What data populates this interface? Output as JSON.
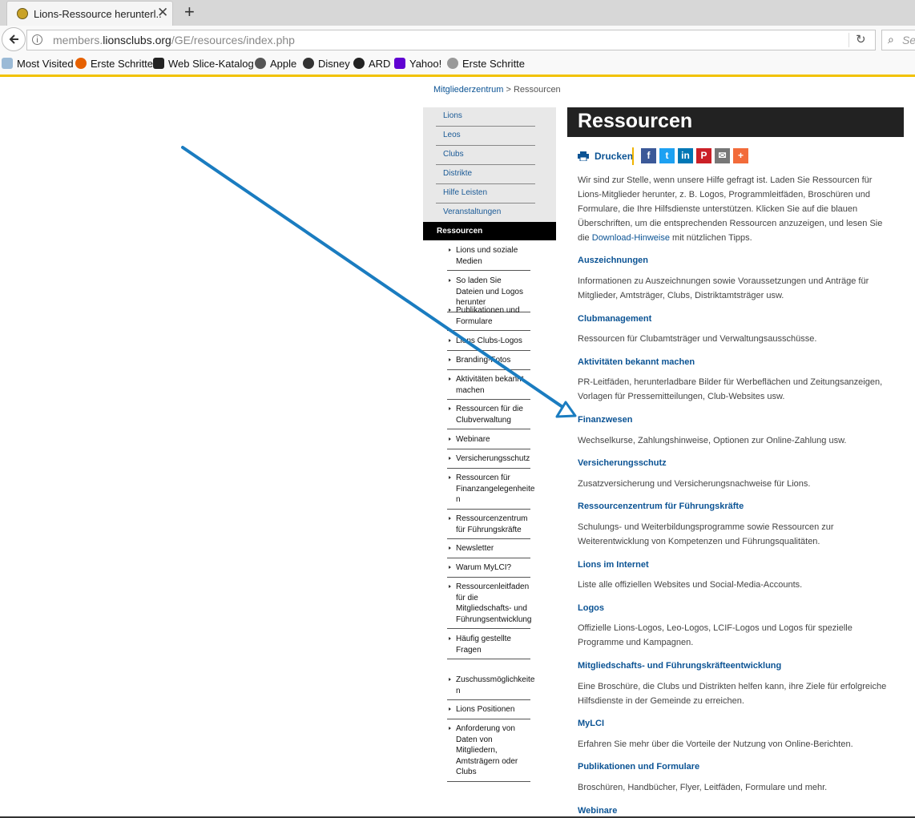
{
  "browser": {
    "tab_title": "Lions-Ressource herunterl...",
    "tab_close": "✕",
    "new_tab": "+",
    "url_prefix": "members.",
    "url_domain": "lionsclubs.org",
    "url_path": "/GE/resources/index.php",
    "search_placeholder": "Se",
    "bookmarks": [
      "Most Visited",
      "Erste Schritte",
      "Web Slice-Katalog",
      "Apple",
      "Disney",
      "ARD",
      "Yahoo!",
      "Erste Schritte"
    ]
  },
  "breadcrumb": {
    "parent": "Mitgliederzentrum",
    "separator": ">",
    "current": "Ressourcen"
  },
  "sidebar": {
    "top_items": [
      "Lions",
      "Leos",
      "Clubs",
      "Distrikte",
      "Hilfe Leisten",
      "Veranstaltungen"
    ],
    "active": "Ressourcen",
    "sub_items": [
      "Lions und soziale Medien",
      "So laden Sie Dateien und Logos herunter",
      "Publikationen und Formulare",
      "Lions Clubs-Logos",
      "Branding-Fotos",
      "Aktivitäten bekannt machen",
      "Ressourcen für die Clubverwaltung",
      "Webinare",
      "Versicherungsschutz",
      "Ressourcen für Finanzangelegenheite n",
      "Ressourcenzentrum für Führungskräfte",
      "Newsletter",
      "Warum MyLCI?",
      "Ressourcenleitfaden für die Mitgliedschafts- und Führungsentwicklung",
      "Häufig gestellte Fragen",
      "Zuschussmöglichkeite n",
      "Lions Positionen",
      "Anforderung von Daten von Mitgliedern, Amtsträgern oder Clubs"
    ]
  },
  "content": {
    "title": "Ressourcen",
    "print_label": "Drucken",
    "share_buttons": [
      {
        "name": "facebook",
        "glyph": "f",
        "color": "#3b5998"
      },
      {
        "name": "twitter",
        "glyph": "t",
        "color": "#1da1f2"
      },
      {
        "name": "linkedin",
        "glyph": "in",
        "color": "#0077b5"
      },
      {
        "name": "pinterest",
        "glyph": "P",
        "color": "#cb2027"
      },
      {
        "name": "email",
        "glyph": "✉",
        "color": "#777777"
      },
      {
        "name": "more",
        "glyph": "+",
        "color": "#f26b3a"
      }
    ],
    "intro_text": "Wir sind zur Stelle, wenn unsere Hilfe gefragt ist. Laden Sie Ressourcen für Lions-Mitglieder herunter, z. B. Logos, Programmleitfäden, Broschüren und Formulare, die Ihre Hilfsdienste unterstützen. Klicken Sie auf die blauen Überschriften, um die entsprechenden Ressourcen anzuzeigen, und lesen Sie die ",
    "intro_link": "Download-Hinweise",
    "intro_suffix": " mit nützlichen Tipps.",
    "sections": [
      {
        "heading": "Auszeichnungen",
        "desc": "Informationen zu Auszeichnungen sowie Voraussetzungen und Anträge für Mitglieder, Amtsträger, Clubs, Distriktamtsträger usw."
      },
      {
        "heading": "Clubmanagement",
        "desc": "Ressourcen für Clubamtsträger und Verwaltungsausschüsse."
      },
      {
        "heading": "Aktivitäten bekannt machen",
        "desc": "PR-Leitfäden, herunterladbare Bilder für Werbeflächen und Zeitungsanzeigen, Vorlagen für Pressemitteilungen, Club-Websites usw."
      },
      {
        "heading": "Finanzwesen",
        "desc": "Wechselkurse, Zahlungshinweise, Optionen zur Online-Zahlung usw."
      },
      {
        "heading": "Versicherungsschutz",
        "desc": "Zusatzversicherung und Versicherungsnachweise für Lions."
      },
      {
        "heading": "Ressourcenzentrum für Führungskräfte",
        "desc": "Schulungs- und Weiterbildungsprogramme sowie Ressourcen zur Weiterentwicklung von Kompetenzen und Führungsqualitäten."
      },
      {
        "heading": "Lions im Internet",
        "desc": "Liste alle offiziellen Websites und Social-Media-Accounts."
      },
      {
        "heading": "Logos",
        "desc": "Offizielle Lions-Logos, Leo-Logos, LCIF-Logos und Logos für spezielle Programme und Kampagnen."
      },
      {
        "heading": "Mitgliedschafts- und Führungskräfteentwicklung",
        "desc": "Eine Broschüre, die Clubs und Distrikten helfen kann, ihre Ziele für erfolgreiche Hilfsdienste in der Gemeinde zu erreichen."
      },
      {
        "heading": "MyLCI",
        "desc": "Erfahren Sie mehr über die Vorteile der Nutzung von Online-Berichten."
      },
      {
        "heading": "Publikationen und Formulare",
        "desc": "Broschüren, Handbücher, Flyer, Leitfäden, Formulare und mehr."
      },
      {
        "heading": "Webinare",
        "desc": ""
      }
    ]
  },
  "annotation": {
    "color": "#1a7cc0"
  }
}
